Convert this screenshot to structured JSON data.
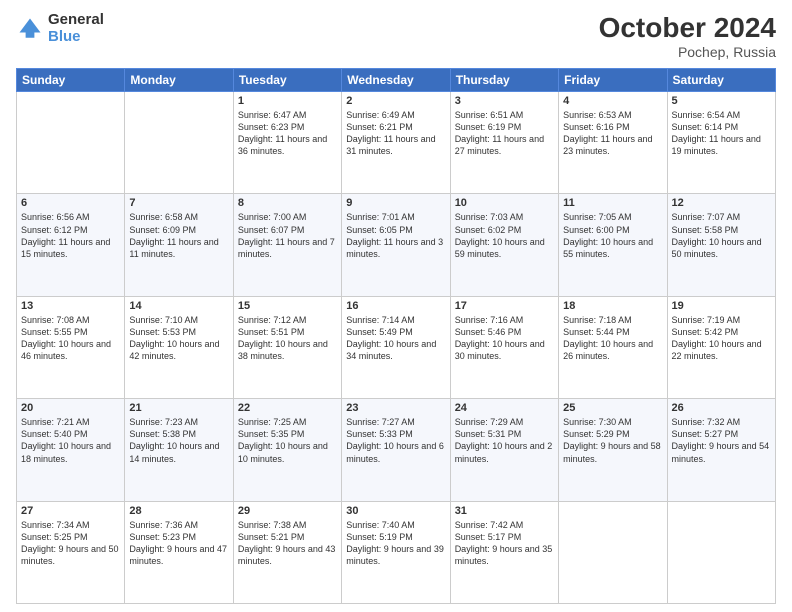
{
  "header": {
    "logo_general": "General",
    "logo_blue": "Blue",
    "month": "October 2024",
    "location": "Pochep, Russia"
  },
  "days_of_week": [
    "Sunday",
    "Monday",
    "Tuesday",
    "Wednesday",
    "Thursday",
    "Friday",
    "Saturday"
  ],
  "weeks": [
    [
      {
        "day": "",
        "info": ""
      },
      {
        "day": "",
        "info": ""
      },
      {
        "day": "1",
        "info": "Sunrise: 6:47 AM\nSunset: 6:23 PM\nDaylight: 11 hours and 36 minutes."
      },
      {
        "day": "2",
        "info": "Sunrise: 6:49 AM\nSunset: 6:21 PM\nDaylight: 11 hours and 31 minutes."
      },
      {
        "day": "3",
        "info": "Sunrise: 6:51 AM\nSunset: 6:19 PM\nDaylight: 11 hours and 27 minutes."
      },
      {
        "day": "4",
        "info": "Sunrise: 6:53 AM\nSunset: 6:16 PM\nDaylight: 11 hours and 23 minutes."
      },
      {
        "day": "5",
        "info": "Sunrise: 6:54 AM\nSunset: 6:14 PM\nDaylight: 11 hours and 19 minutes."
      }
    ],
    [
      {
        "day": "6",
        "info": "Sunrise: 6:56 AM\nSunset: 6:12 PM\nDaylight: 11 hours and 15 minutes."
      },
      {
        "day": "7",
        "info": "Sunrise: 6:58 AM\nSunset: 6:09 PM\nDaylight: 11 hours and 11 minutes."
      },
      {
        "day": "8",
        "info": "Sunrise: 7:00 AM\nSunset: 6:07 PM\nDaylight: 11 hours and 7 minutes."
      },
      {
        "day": "9",
        "info": "Sunrise: 7:01 AM\nSunset: 6:05 PM\nDaylight: 11 hours and 3 minutes."
      },
      {
        "day": "10",
        "info": "Sunrise: 7:03 AM\nSunset: 6:02 PM\nDaylight: 10 hours and 59 minutes."
      },
      {
        "day": "11",
        "info": "Sunrise: 7:05 AM\nSunset: 6:00 PM\nDaylight: 10 hours and 55 minutes."
      },
      {
        "day": "12",
        "info": "Sunrise: 7:07 AM\nSunset: 5:58 PM\nDaylight: 10 hours and 50 minutes."
      }
    ],
    [
      {
        "day": "13",
        "info": "Sunrise: 7:08 AM\nSunset: 5:55 PM\nDaylight: 10 hours and 46 minutes."
      },
      {
        "day": "14",
        "info": "Sunrise: 7:10 AM\nSunset: 5:53 PM\nDaylight: 10 hours and 42 minutes."
      },
      {
        "day": "15",
        "info": "Sunrise: 7:12 AM\nSunset: 5:51 PM\nDaylight: 10 hours and 38 minutes."
      },
      {
        "day": "16",
        "info": "Sunrise: 7:14 AM\nSunset: 5:49 PM\nDaylight: 10 hours and 34 minutes."
      },
      {
        "day": "17",
        "info": "Sunrise: 7:16 AM\nSunset: 5:46 PM\nDaylight: 10 hours and 30 minutes."
      },
      {
        "day": "18",
        "info": "Sunrise: 7:18 AM\nSunset: 5:44 PM\nDaylight: 10 hours and 26 minutes."
      },
      {
        "day": "19",
        "info": "Sunrise: 7:19 AM\nSunset: 5:42 PM\nDaylight: 10 hours and 22 minutes."
      }
    ],
    [
      {
        "day": "20",
        "info": "Sunrise: 7:21 AM\nSunset: 5:40 PM\nDaylight: 10 hours and 18 minutes."
      },
      {
        "day": "21",
        "info": "Sunrise: 7:23 AM\nSunset: 5:38 PM\nDaylight: 10 hours and 14 minutes."
      },
      {
        "day": "22",
        "info": "Sunrise: 7:25 AM\nSunset: 5:35 PM\nDaylight: 10 hours and 10 minutes."
      },
      {
        "day": "23",
        "info": "Sunrise: 7:27 AM\nSunset: 5:33 PM\nDaylight: 10 hours and 6 minutes."
      },
      {
        "day": "24",
        "info": "Sunrise: 7:29 AM\nSunset: 5:31 PM\nDaylight: 10 hours and 2 minutes."
      },
      {
        "day": "25",
        "info": "Sunrise: 7:30 AM\nSunset: 5:29 PM\nDaylight: 9 hours and 58 minutes."
      },
      {
        "day": "26",
        "info": "Sunrise: 7:32 AM\nSunset: 5:27 PM\nDaylight: 9 hours and 54 minutes."
      }
    ],
    [
      {
        "day": "27",
        "info": "Sunrise: 7:34 AM\nSunset: 5:25 PM\nDaylight: 9 hours and 50 minutes."
      },
      {
        "day": "28",
        "info": "Sunrise: 7:36 AM\nSunset: 5:23 PM\nDaylight: 9 hours and 47 minutes."
      },
      {
        "day": "29",
        "info": "Sunrise: 7:38 AM\nSunset: 5:21 PM\nDaylight: 9 hours and 43 minutes."
      },
      {
        "day": "30",
        "info": "Sunrise: 7:40 AM\nSunset: 5:19 PM\nDaylight: 9 hours and 39 minutes."
      },
      {
        "day": "31",
        "info": "Sunrise: 7:42 AM\nSunset: 5:17 PM\nDaylight: 9 hours and 35 minutes."
      },
      {
        "day": "",
        "info": ""
      },
      {
        "day": "",
        "info": ""
      }
    ]
  ]
}
